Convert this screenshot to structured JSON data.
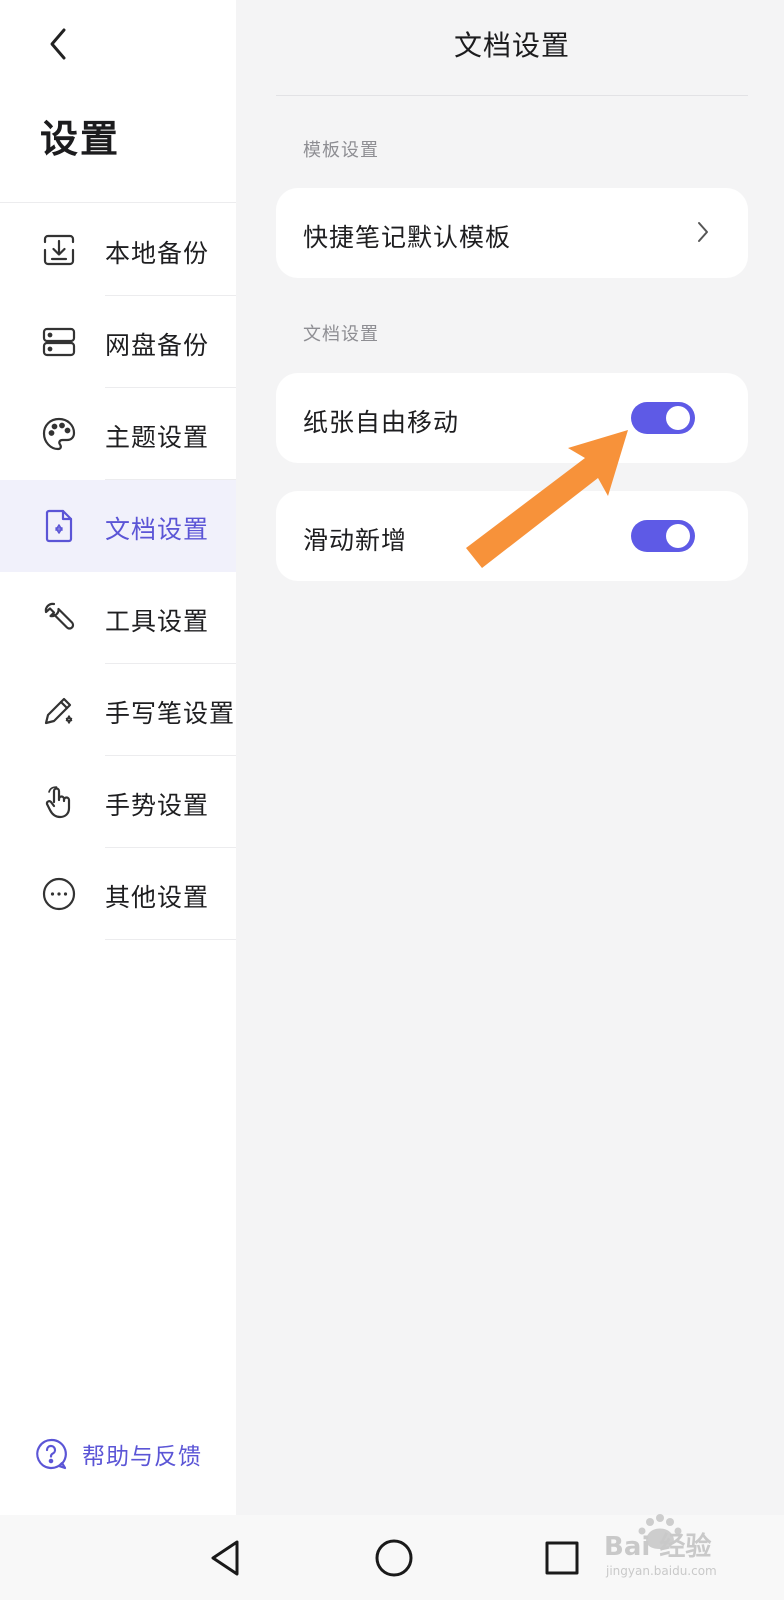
{
  "sidebar": {
    "title": "设置",
    "items": [
      {
        "label": "本地备份",
        "icon": "local-backup-icon",
        "active": false
      },
      {
        "label": "网盘备份",
        "icon": "cloud-backup-icon",
        "active": false
      },
      {
        "label": "主题设置",
        "icon": "palette-icon",
        "active": false
      },
      {
        "label": "文档设置",
        "icon": "document-settings-icon",
        "active": true
      },
      {
        "label": "工具设置",
        "icon": "wrench-icon",
        "active": false
      },
      {
        "label": "手写笔设置",
        "icon": "pen-settings-icon",
        "active": false
      },
      {
        "label": "手势设置",
        "icon": "hand-gesture-icon",
        "active": false
      },
      {
        "label": "其他设置",
        "icon": "more-icon",
        "active": false
      }
    ],
    "help_label": "帮助与反馈"
  },
  "main": {
    "title": "文档设置",
    "sections": [
      {
        "label": "模板设置",
        "rows": [
          {
            "label": "快捷笔记默认模板",
            "control": "chevron"
          }
        ]
      },
      {
        "label": "文档设置",
        "rows": [
          {
            "label": "纸张自由移动",
            "control": "toggle",
            "on": true
          },
          {
            "label": "滑动新增",
            "control": "toggle",
            "on": true
          }
        ]
      }
    ]
  },
  "colors": {
    "accent": "#5e5ae6",
    "active_text": "#5b55d6",
    "arrow": "#f7923a"
  },
  "watermark": {
    "text": "Bai 经验",
    "sub": "jingyan.baidu.com"
  }
}
